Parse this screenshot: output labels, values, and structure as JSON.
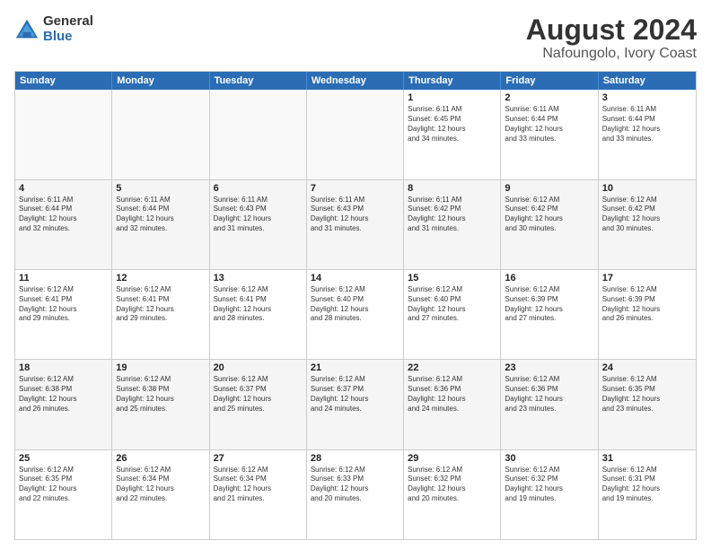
{
  "logo": {
    "general": "General",
    "blue": "Blue"
  },
  "title": "August 2024",
  "subtitle": "Nafoungolo, Ivory Coast",
  "days": [
    "Sunday",
    "Monday",
    "Tuesday",
    "Wednesday",
    "Thursday",
    "Friday",
    "Saturday"
  ],
  "weeks": [
    [
      {
        "day": "",
        "text": "",
        "empty": true
      },
      {
        "day": "",
        "text": "",
        "empty": true
      },
      {
        "day": "",
        "text": "",
        "empty": true
      },
      {
        "day": "",
        "text": "",
        "empty": true
      },
      {
        "day": "1",
        "text": "Sunrise: 6:11 AM\nSunset: 6:45 PM\nDaylight: 12 hours\nand 34 minutes."
      },
      {
        "day": "2",
        "text": "Sunrise: 6:11 AM\nSunset: 6:44 PM\nDaylight: 12 hours\nand 33 minutes."
      },
      {
        "day": "3",
        "text": "Sunrise: 6:11 AM\nSunset: 6:44 PM\nDaylight: 12 hours\nand 33 minutes."
      }
    ],
    [
      {
        "day": "4",
        "text": "Sunrise: 6:11 AM\nSunset: 6:44 PM\nDaylight: 12 hours\nand 32 minutes."
      },
      {
        "day": "5",
        "text": "Sunrise: 6:11 AM\nSunset: 6:44 PM\nDaylight: 12 hours\nand 32 minutes."
      },
      {
        "day": "6",
        "text": "Sunrise: 6:11 AM\nSunset: 6:43 PM\nDaylight: 12 hours\nand 31 minutes."
      },
      {
        "day": "7",
        "text": "Sunrise: 6:11 AM\nSunset: 6:43 PM\nDaylight: 12 hours\nand 31 minutes."
      },
      {
        "day": "8",
        "text": "Sunrise: 6:11 AM\nSunset: 6:42 PM\nDaylight: 12 hours\nand 31 minutes."
      },
      {
        "day": "9",
        "text": "Sunrise: 6:12 AM\nSunset: 6:42 PM\nDaylight: 12 hours\nand 30 minutes."
      },
      {
        "day": "10",
        "text": "Sunrise: 6:12 AM\nSunset: 6:42 PM\nDaylight: 12 hours\nand 30 minutes."
      }
    ],
    [
      {
        "day": "11",
        "text": "Sunrise: 6:12 AM\nSunset: 6:41 PM\nDaylight: 12 hours\nand 29 minutes."
      },
      {
        "day": "12",
        "text": "Sunrise: 6:12 AM\nSunset: 6:41 PM\nDaylight: 12 hours\nand 29 minutes."
      },
      {
        "day": "13",
        "text": "Sunrise: 6:12 AM\nSunset: 6:41 PM\nDaylight: 12 hours\nand 28 minutes."
      },
      {
        "day": "14",
        "text": "Sunrise: 6:12 AM\nSunset: 6:40 PM\nDaylight: 12 hours\nand 28 minutes."
      },
      {
        "day": "15",
        "text": "Sunrise: 6:12 AM\nSunset: 6:40 PM\nDaylight: 12 hours\nand 27 minutes."
      },
      {
        "day": "16",
        "text": "Sunrise: 6:12 AM\nSunset: 6:39 PM\nDaylight: 12 hours\nand 27 minutes."
      },
      {
        "day": "17",
        "text": "Sunrise: 6:12 AM\nSunset: 6:39 PM\nDaylight: 12 hours\nand 26 minutes."
      }
    ],
    [
      {
        "day": "18",
        "text": "Sunrise: 6:12 AM\nSunset: 6:38 PM\nDaylight: 12 hours\nand 26 minutes."
      },
      {
        "day": "19",
        "text": "Sunrise: 6:12 AM\nSunset: 6:38 PM\nDaylight: 12 hours\nand 25 minutes."
      },
      {
        "day": "20",
        "text": "Sunrise: 6:12 AM\nSunset: 6:37 PM\nDaylight: 12 hours\nand 25 minutes."
      },
      {
        "day": "21",
        "text": "Sunrise: 6:12 AM\nSunset: 6:37 PM\nDaylight: 12 hours\nand 24 minutes."
      },
      {
        "day": "22",
        "text": "Sunrise: 6:12 AM\nSunset: 6:36 PM\nDaylight: 12 hours\nand 24 minutes."
      },
      {
        "day": "23",
        "text": "Sunrise: 6:12 AM\nSunset: 6:36 PM\nDaylight: 12 hours\nand 23 minutes."
      },
      {
        "day": "24",
        "text": "Sunrise: 6:12 AM\nSunset: 6:35 PM\nDaylight: 12 hours\nand 23 minutes."
      }
    ],
    [
      {
        "day": "25",
        "text": "Sunrise: 6:12 AM\nSunset: 6:35 PM\nDaylight: 12 hours\nand 22 minutes."
      },
      {
        "day": "26",
        "text": "Sunrise: 6:12 AM\nSunset: 6:34 PM\nDaylight: 12 hours\nand 22 minutes."
      },
      {
        "day": "27",
        "text": "Sunrise: 6:12 AM\nSunset: 6:34 PM\nDaylight: 12 hours\nand 21 minutes."
      },
      {
        "day": "28",
        "text": "Sunrise: 6:12 AM\nSunset: 6:33 PM\nDaylight: 12 hours\nand 20 minutes."
      },
      {
        "day": "29",
        "text": "Sunrise: 6:12 AM\nSunset: 6:32 PM\nDaylight: 12 hours\nand 20 minutes."
      },
      {
        "day": "30",
        "text": "Sunrise: 6:12 AM\nSunset: 6:32 PM\nDaylight: 12 hours\nand 19 minutes."
      },
      {
        "day": "31",
        "text": "Sunrise: 6:12 AM\nSunset: 6:31 PM\nDaylight: 12 hours\nand 19 minutes."
      }
    ]
  ]
}
